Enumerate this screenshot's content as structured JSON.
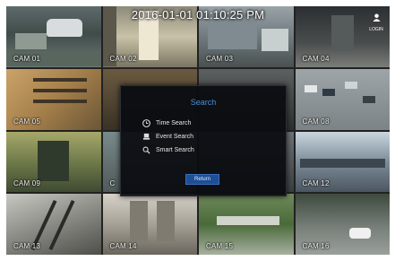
{
  "datetime": "2016-01-01 01:10:25 PM",
  "user_label": "LOGIN",
  "cameras": [
    {
      "label": "CAM 01"
    },
    {
      "label": "CAM 02"
    },
    {
      "label": "CAM 03"
    },
    {
      "label": "CAM 04"
    },
    {
      "label": "CAM 05"
    },
    {
      "label": ""
    },
    {
      "label": ""
    },
    {
      "label": "CAM 08"
    },
    {
      "label": "CAM 09"
    },
    {
      "label": "C"
    },
    {
      "label": ""
    },
    {
      "label": "CAM 12"
    },
    {
      "label": "CAM 13"
    },
    {
      "label": "CAM 14"
    },
    {
      "label": "CAM 15"
    },
    {
      "label": "CAM 16"
    }
  ],
  "search_dialog": {
    "title": "Search",
    "items": [
      {
        "label": "Time Search",
        "icon": "clock-icon"
      },
      {
        "label": "Event Search",
        "icon": "event-icon"
      },
      {
        "label": "Smart Search",
        "icon": "smart-search-icon"
      }
    ],
    "return_label": "Return"
  },
  "colors": {
    "accent": "#4a8fd6",
    "button": "#1d4f96"
  }
}
